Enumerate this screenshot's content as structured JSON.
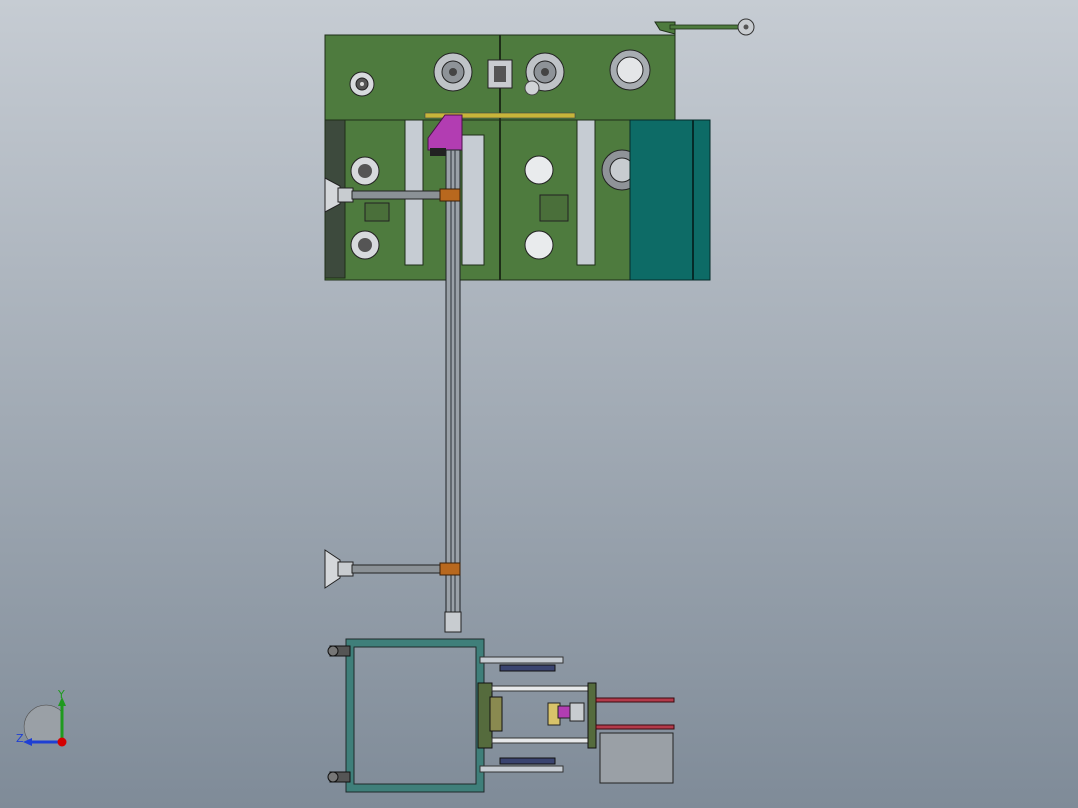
{
  "viewport": {
    "background_top": "#c6ccd3",
    "background_bottom": "#7f8b98"
  },
  "triad": {
    "x_axis_label": "",
    "y_axis_label": "Y",
    "z_axis_label": "Z",
    "x_color": "#d40000",
    "y_color": "#1f9a1f",
    "z_color": "#1f3fd4"
  },
  "colors": {
    "machine_green": "#4e7b3e",
    "machine_green_dark": "#3d6530",
    "teal_panel": "#0d6b66",
    "teal_dark": "#0a4f4b",
    "magenta_bracket": "#b23db2",
    "orange_block": "#b8681e",
    "yellow_rail": "#c7b53a",
    "steel": "#a9afb5",
    "steel_dark": "#5b6168",
    "frame_teal": "#3f7f7a",
    "navy_bar": "#3a4470",
    "red_rod": "#b33a4a",
    "grey_box": "#9aa0a6"
  }
}
